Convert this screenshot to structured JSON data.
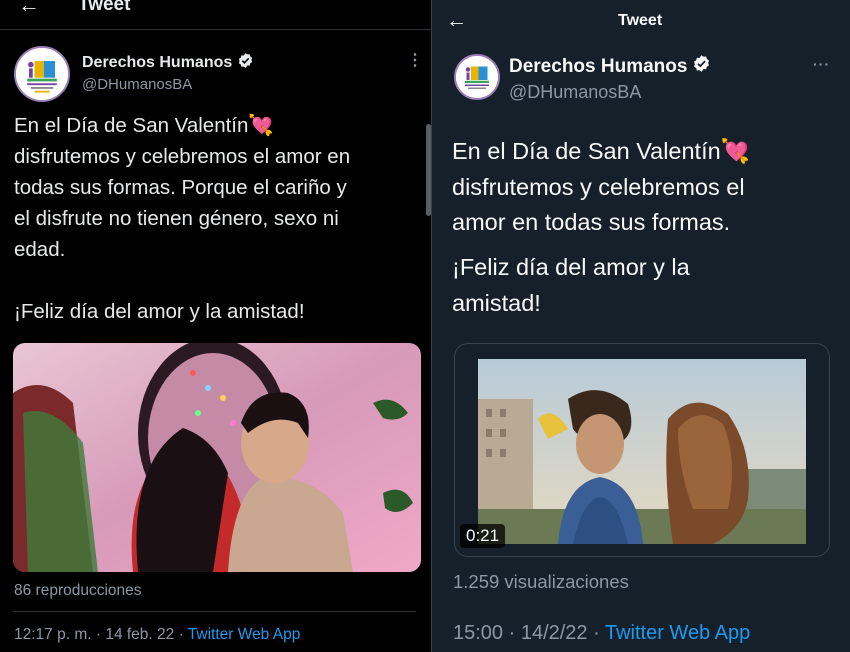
{
  "left": {
    "header_title": "Tweet",
    "back_icon": "arrow-left-icon",
    "account": {
      "name": "Derechos Humanos",
      "handle": "@DHumanosBA",
      "verified_icon": "verified-badge-icon"
    },
    "more_label": "⋮",
    "tweet_text": "En el Día de San Valentín💘\ndisfrutemos y celebremos el amor en\ntodas sus formas. Porque el cariño y\nel disfrute no tienen género, sexo ni\nedad.\n\n¡Feliz día del amor y la amistad!",
    "views": "86 reproducciones",
    "time_date": "12:17 p. m. · 14 feb. 22 · ",
    "source": "Twitter Web App"
  },
  "right": {
    "header_title": "Tweet",
    "back_icon": "arrow-left-icon",
    "account": {
      "name": "Derechos Humanos",
      "handle": "@DHumanosBA",
      "verified_icon": "verified-badge-icon"
    },
    "more_label": "···",
    "tweet_text": "En el Día de San Valentín💘\ndisfrutemos y celebremos el\namor en todas sus formas.",
    "tweet_text_2": "¡Feliz día del amor y la\namistad!",
    "video_duration": "0:21",
    "views": "1.259 visualizaciones",
    "time_date": "15:00 · 14/2/22 · ",
    "source": "Twitter Web App"
  },
  "colors": {
    "link": "#1d9bf0",
    "muted": "#8b98a5",
    "dim_bg": "#15202b",
    "black_bg": "#000000"
  }
}
